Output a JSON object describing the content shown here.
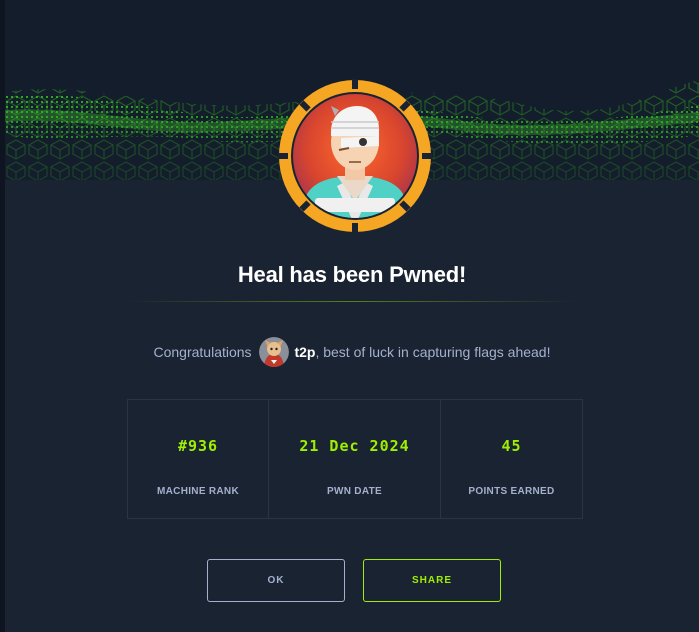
{
  "modal": {
    "title": "Heal has been Pwned!",
    "congrats_prefix": "Congratulations",
    "username": "t2p",
    "congrats_suffix": ", best of luck in capturing flags ahead!"
  },
  "stats": [
    {
      "value": "#936",
      "label": "MACHINE RANK"
    },
    {
      "value": "21 Dec 2024",
      "label": "PWN DATE"
    },
    {
      "value": "45",
      "label": "POINTS EARNED"
    }
  ],
  "buttons": {
    "ok_label": "OK",
    "share_label": "SHARE"
  },
  "colors": {
    "accent": "#9fef00",
    "ring": "#f5a623",
    "background": "#1a2332"
  },
  "icons": {
    "machine_avatar": "machine-avatar-icon",
    "user_avatar": "user-avatar-icon",
    "banner": "green-cube-wave-banner"
  }
}
